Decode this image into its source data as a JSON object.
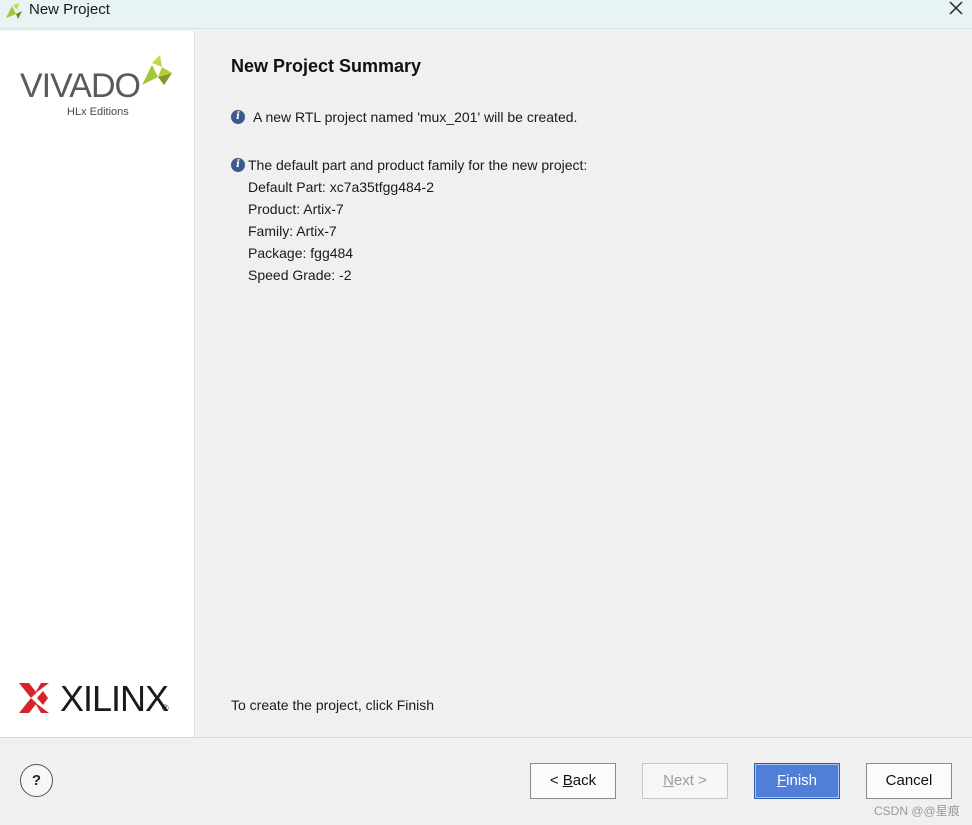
{
  "window": {
    "title": "New Project",
    "close_icon": "close-icon"
  },
  "sidebar": {
    "vivado_logo_text": "VIVADO",
    "vivado_logo_sub": "HLx Editions",
    "xilinx_logo_text": "XILINX",
    "xilinx_logo_reg": "®"
  },
  "summary": {
    "heading": "New Project Summary",
    "created_line": "A new RTL project named 'mux_201' will be created.",
    "part_intro": "The default part and product family for the new project:",
    "default_part": "Default Part: xc7a35tfgg484-2",
    "product": "Product: Artix-7",
    "family": "Family: Artix-7",
    "package": "Package: fgg484",
    "speed_grade": "Speed Grade: -2",
    "finish_hint": "To create the project, click Finish"
  },
  "buttons": {
    "help": "?",
    "back_prefix": "< ",
    "back_mnemonic": "B",
    "back_rest": "ack",
    "next_mnemonic": "N",
    "next_rest": "ext >",
    "finish_mnemonic": "F",
    "finish_rest": "inish",
    "cancel": "Cancel"
  },
  "watermark": "CSDN @@星痕",
  "colors": {
    "titlebar": "#e7f4f3",
    "accent": "#4f7fd6",
    "info_icon": "#3d5a8c",
    "xilinx_red": "#d6232c",
    "vivado_leaf": "#a4c639"
  }
}
